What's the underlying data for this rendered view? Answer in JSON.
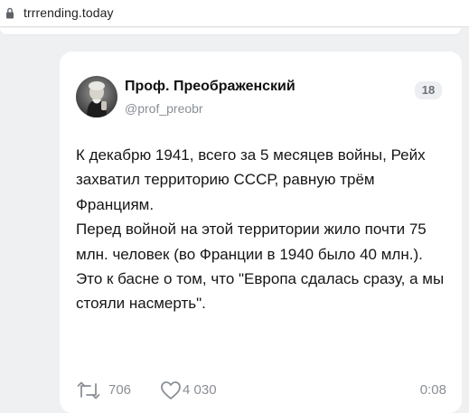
{
  "browser": {
    "url": "trrrending.today",
    "lock_icon": "lock-icon"
  },
  "post": {
    "author_name": "Проф. Преображенский",
    "handle": "@prof_preobr",
    "badge": "18",
    "avatar": "avatar-photo",
    "paragraphs": [
      "К декабрю 1941, всего за 5 месяцев войны, Рейх захватил территорию СССР, равную трём Франциям.",
      "Перед войной на этой территории жило почти 75 млн. человек (во Франции в 1940 было 40 млн.).",
      "Это к басне о том, что \"Европа сдалась сразу, а мы стояли насмерть\"."
    ],
    "stats": {
      "retweets": "706",
      "likes": "4 030",
      "time": "0:08",
      "retweet_icon": "retweet-icon",
      "like_icon": "heart-icon"
    }
  },
  "colors": {
    "background": "#eef0f2",
    "card": "#ffffff",
    "muted": "#8a8f96",
    "text": "#161616"
  }
}
